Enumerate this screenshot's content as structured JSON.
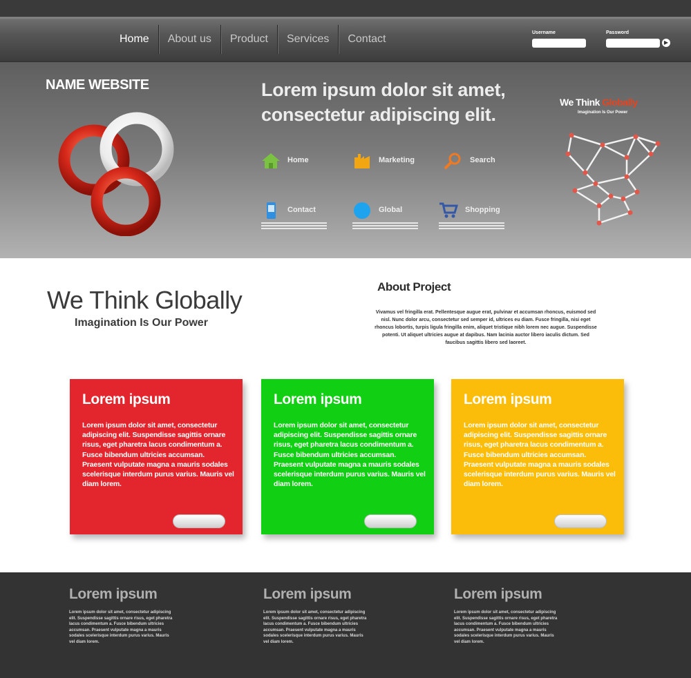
{
  "nav": {
    "items": [
      {
        "label": "Home",
        "active": true
      },
      {
        "label": "About us",
        "active": false
      },
      {
        "label": "Product",
        "active": false
      },
      {
        "label": "Services",
        "active": false
      },
      {
        "label": "Contact",
        "active": false
      }
    ],
    "username_label": "Username",
    "password_label": "Password",
    "submit_glyph": "▶"
  },
  "hero": {
    "site_name": "NAME WEBSITE",
    "headline_line1": "Lorem ipsum dolor sit amet,",
    "headline_line2": "consectetur adipiscing elit.",
    "features": [
      {
        "label": "Home",
        "icon": "house-icon",
        "color": "#7cc242"
      },
      {
        "label": "Marketing",
        "icon": "factory-icon",
        "color": "#f2a611"
      },
      {
        "label": "Search",
        "icon": "magnifier-icon",
        "color": "#f07a22"
      },
      {
        "label": "Contact",
        "icon": "phone-icon",
        "color": "#2f8fe0"
      },
      {
        "label": "Global",
        "icon": "globe-icon",
        "color": "#1ea3ef"
      },
      {
        "label": "Shopping",
        "icon": "cart-icon",
        "color": "#3457a6"
      }
    ],
    "globe_title_prefix": "We Think ",
    "globe_title_highlight": "Globally",
    "globe_tagline": "Imagination Is Our Power"
  },
  "main": {
    "title": "We Think Globally",
    "tagline": "Imagination Is Our Power",
    "about_title": "About Project",
    "about_body": "Vivamus vel fringilla erat. Pellentesque augue erat, pulvinar et accumsan rhoncus, euismod sed nisl. Nunc dolor arcu, consectetur sed semper id, ultrices eu diam. Fusce fringilla, nisi eget rhoncus lobortis, turpis ligula fringilla enim, aliquet tristique nibh lorem nec augue. Suspendisse potenti. Ut aliquet ultricies augue at dapibus. Nam lacinia auctor libero iaculis dictum. Sed faucibus sagittis libero sed laoreet."
  },
  "cards": [
    {
      "title": "Lorem ipsum",
      "color": "#e3262d",
      "body": "Lorem ipsum dolor sit amet, consectetur adipiscing elit. Suspendisse sagittis ornare risus, eget pharetra lacus condimentum a. Fusce bibendum ultricies accumsan. Praesent vulputate magna a mauris sodales scelerisque interdum purus varius. Mauris vel diam lorem."
    },
    {
      "title": "Lorem ipsum",
      "color": "#11cf12",
      "body": "Lorem ipsum dolor sit amet, consectetur adipiscing elit. Suspendisse sagittis ornare risus, eget pharetra lacus condimentum a. Fusce bibendum ultricies accumsan. Praesent vulputate magna a mauris sodales scelerisque interdum purus varius. Mauris vel diam lorem."
    },
    {
      "title": "Lorem ipsum",
      "color": "#fbbd0a",
      "body": "Lorem ipsum dolor sit amet, consectetur adipiscing elit. Suspendisse sagittis ornare risus, eget pharetra lacus condimentum a. Fusce bibendum ultricies accumsan. Praesent vulputate magna a mauris sodales scelerisque interdum purus varius. Mauris vel diam lorem."
    }
  ],
  "footer": {
    "columns": [
      {
        "title": "Lorem ipsum",
        "body": "Lorem ipsum dolor sit amet, consectetur adipiscing elit. Suspendisse sagittis ornare risus, eget pharetra lacus condimentum a. Fusce bibendum ultricies accumsan. Praesent vulputate magna a mauris sodales scelerisque interdum purus varius. Mauris vel diam lorem."
      },
      {
        "title": "Lorem ipsum",
        "body": "Lorem ipsum dolor sit amet, consectetur adipiscing elit. Suspendisse sagittis ornare risus, eget pharetra lacus condimentum a. Fusce bibendum ultricies accumsan. Praesent vulputate magna a mauris sodales scelerisque interdum purus varius. Mauris vel diam lorem."
      },
      {
        "title": "Lorem ipsum",
        "body": "Lorem ipsum dolor sit amet, consectetur adipiscing elit. Suspendisse sagittis ornare risus, eget pharetra lacus condimentum a. Fusce bibendum ultricies accumsan. Praesent vulputate magna a mauris sodales scelerisque interdum purus varius. Mauris vel diam lorem."
      }
    ]
  }
}
